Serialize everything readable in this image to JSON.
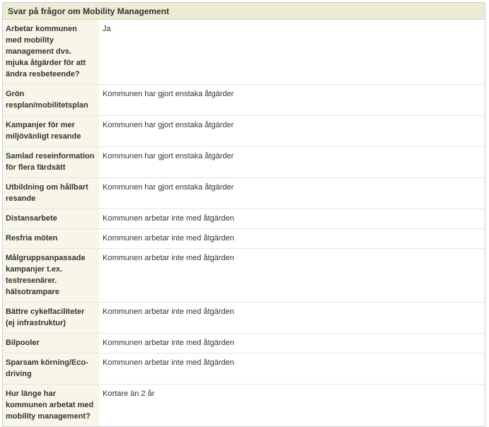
{
  "panel": {
    "title": "Svar på frågor om Mobility Management"
  },
  "rows": [
    {
      "question": "Arbetar kommunen med mobility management dvs. mjuka åtgärder för att ändra resbeteende?",
      "answer": "Ja"
    },
    {
      "question": "Grön resplan/mobilitetsplan",
      "answer": "Kommunen har gjort enstaka åtgärder"
    },
    {
      "question": "Kampanjer för mer miljövänligt resande",
      "answer": "Kommunen har gjort enstaka åtgärder"
    },
    {
      "question": "Samlad reseinformation för flera färdsätt",
      "answer": "Kommunen har gjort enstaka åtgärder"
    },
    {
      "question": "Utbildning om hållbart resande",
      "answer": "Kommunen har gjort enstaka åtgärder"
    },
    {
      "question": "Distansarbete",
      "answer": "Kommunen arbetar inte med åtgärden"
    },
    {
      "question": "Resfria möten",
      "answer": "Kommunen arbetar inte med åtgärden"
    },
    {
      "question": "Målgruppsanpassade kampanjer t.ex. testresenärer. hälsotrampare",
      "answer": "Kommunen arbetar inte med åtgärden"
    },
    {
      "question": "Bättre cykelfaciliteter (ej infrastruktur)",
      "answer": "Kommunen arbetar inte med åtgärden"
    },
    {
      "question": "Bilpooler",
      "answer": "Kommunen arbetar inte med åtgärden"
    },
    {
      "question": "Sparsam körning/Eco-driving",
      "answer": "Kommunen arbetar inte med åtgärden"
    },
    {
      "question": "Hur länge har kommunen arbetat med mobility management?",
      "answer": "Kortare än 2 år"
    }
  ]
}
